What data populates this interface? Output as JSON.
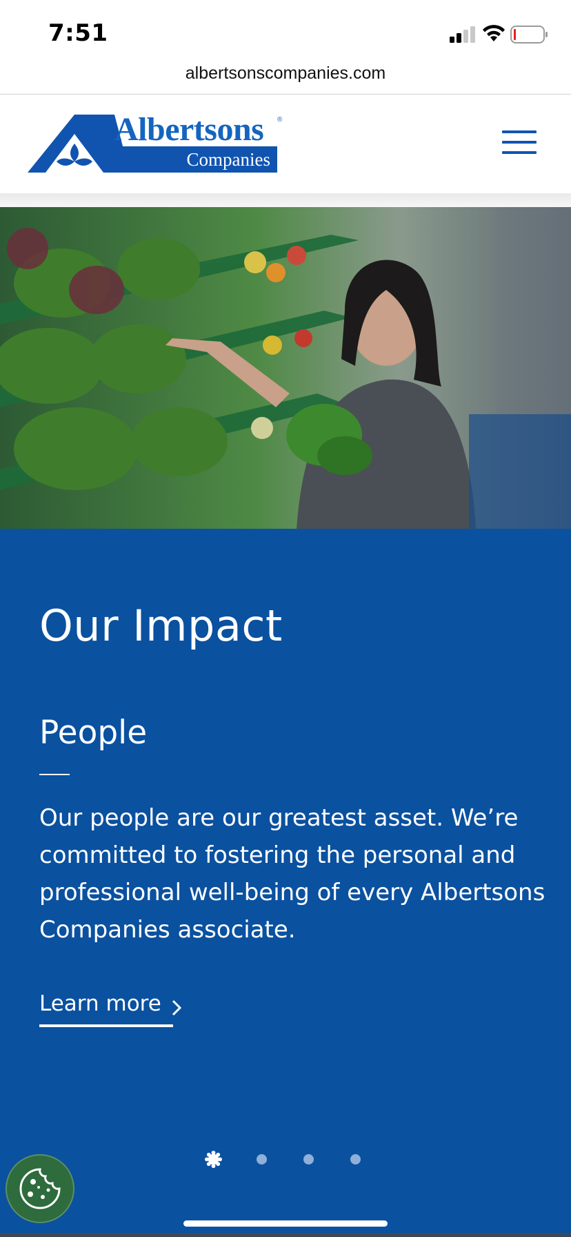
{
  "status_bar": {
    "time": "7:51"
  },
  "browser": {
    "url": "albertsonscompanies.com"
  },
  "header": {
    "logo_text": "Albertsons",
    "logo_registered": "®",
    "logo_subtext": "Companies"
  },
  "hero": {
    "icon": "produce-photo"
  },
  "impact": {
    "section_title": "Our Impact",
    "card_title": "People",
    "card_body": "Our people are our greatest asset. We’re committed to fostering the personal and professional well-being of every Albertsons Companies associate.",
    "link_label": "Learn more"
  },
  "carousel": {
    "total_slides": 4,
    "active_index": 0
  },
  "colors": {
    "brand_blue": "#0a51a0",
    "logo_blue": "#1565c0",
    "cookie_green": "#2e6b3d"
  }
}
